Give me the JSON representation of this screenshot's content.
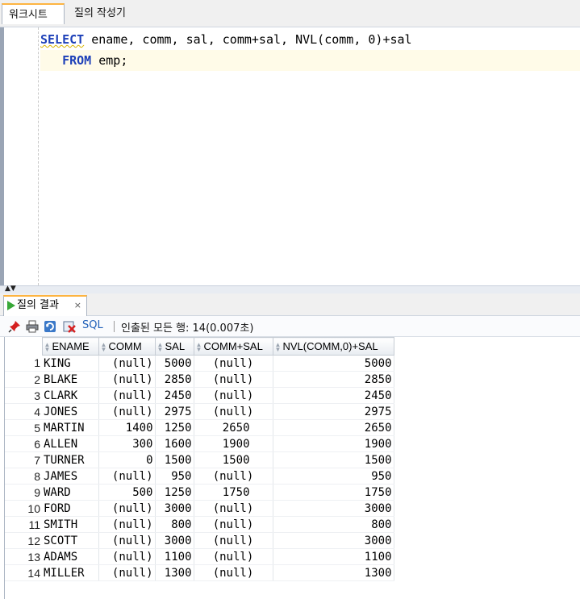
{
  "tabs": [
    {
      "label": "워크시트"
    },
    {
      "label": "질의 작성기"
    }
  ],
  "editor": {
    "line1_keyword": "SELECT",
    "line1_rest_a": " ename, comm, sal, comm+sal, NVL(comm, ",
    "line1_number": "0",
    "line1_rest_b": ")+sal",
    "line2_indent": "   ",
    "line2_keyword": "FROM",
    "line2_rest": " emp;"
  },
  "result_tab": {
    "label": "질의 결과",
    "close": "×"
  },
  "toolbar": {
    "sql_label": "SQL",
    "status": "인출된 모든 행: 14(0.007초)"
  },
  "grid": {
    "columns": [
      "ENAME",
      "COMM",
      "SAL",
      "COMM+SAL",
      "NVL(COMM,0)+SAL"
    ],
    "rows": [
      {
        "n": "1",
        "ename": "KING",
        "comm": "(null)",
        "sal": "5000",
        "cs": "(null)",
        "nvl": "5000"
      },
      {
        "n": "2",
        "ename": "BLAKE",
        "comm": "(null)",
        "sal": "2850",
        "cs": "(null)",
        "nvl": "2850"
      },
      {
        "n": "3",
        "ename": "CLARK",
        "comm": "(null)",
        "sal": "2450",
        "cs": "(null)",
        "nvl": "2450"
      },
      {
        "n": "4",
        "ename": "JONES",
        "comm": "(null)",
        "sal": "2975",
        "cs": "(null)",
        "nvl": "2975"
      },
      {
        "n": "5",
        "ename": "MARTIN",
        "comm": "1400",
        "sal": "1250",
        "cs": "2650",
        "nvl": "2650"
      },
      {
        "n": "6",
        "ename": "ALLEN",
        "comm": "300",
        "sal": "1600",
        "cs": "1900",
        "nvl": "1900"
      },
      {
        "n": "7",
        "ename": "TURNER",
        "comm": "0",
        "sal": "1500",
        "cs": "1500",
        "nvl": "1500"
      },
      {
        "n": "8",
        "ename": "JAMES",
        "comm": "(null)",
        "sal": "950",
        "cs": "(null)",
        "nvl": "950"
      },
      {
        "n": "9",
        "ename": "WARD",
        "comm": "500",
        "sal": "1250",
        "cs": "1750",
        "nvl": "1750"
      },
      {
        "n": "10",
        "ename": "FORD",
        "comm": "(null)",
        "sal": "3000",
        "cs": "(null)",
        "nvl": "3000"
      },
      {
        "n": "11",
        "ename": "SMITH",
        "comm": "(null)",
        "sal": "800",
        "cs": "(null)",
        "nvl": "800"
      },
      {
        "n": "12",
        "ename": "SCOTT",
        "comm": "(null)",
        "sal": "3000",
        "cs": "(null)",
        "nvl": "3000"
      },
      {
        "n": "13",
        "ename": "ADAMS",
        "comm": "(null)",
        "sal": "1100",
        "cs": "(null)",
        "nvl": "1100"
      },
      {
        "n": "14",
        "ename": "MILLER",
        "comm": "(null)",
        "sal": "1300",
        "cs": "(null)",
        "nvl": "1300"
      }
    ]
  },
  "colors": {
    "keyword": "#1c3fb8",
    "active_tab_accent": "#fdb441",
    "current_line": "#fffbe8",
    "run_icon": "#38a838",
    "link": "#1f5fb8"
  }
}
